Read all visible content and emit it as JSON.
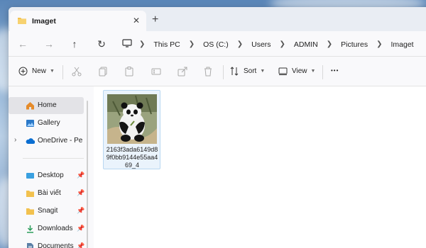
{
  "tab": {
    "title": "Imaget",
    "close_glyph": "✕",
    "add_glyph": "+"
  },
  "nav": {
    "back": "←",
    "forward": "→",
    "up": "↑",
    "refresh": "↻"
  },
  "breadcrumb": [
    "This PC",
    "OS (C:)",
    "Users",
    "ADMIN",
    "Pictures",
    "Imaget"
  ],
  "toolbar": {
    "new_label": "New",
    "sort_label": "Sort",
    "view_label": "View",
    "more_glyph": "•••"
  },
  "sidebar": {
    "items": [
      {
        "label": "Home"
      },
      {
        "label": "Gallery"
      },
      {
        "label": "OneDrive - Persona"
      },
      {
        "label": "Desktop"
      },
      {
        "label": "Bài viết"
      },
      {
        "label": "Snagit"
      },
      {
        "label": "Downloads"
      },
      {
        "label": "Documents"
      }
    ]
  },
  "files": [
    {
      "name": "2163f3ada6149d89f0bb9144e55aa469_4"
    }
  ],
  "colors": {
    "accent": "#0067c0",
    "folder": "#f2c14e",
    "selection": "#eaf3fc"
  },
  "icons": [
    "folder-icon",
    "home-icon",
    "gallery-icon",
    "cloud-icon",
    "desktop-icon",
    "download-icon",
    "document-icon",
    "pin-icon",
    "monitor-icon",
    "chevron-right-icon"
  ]
}
